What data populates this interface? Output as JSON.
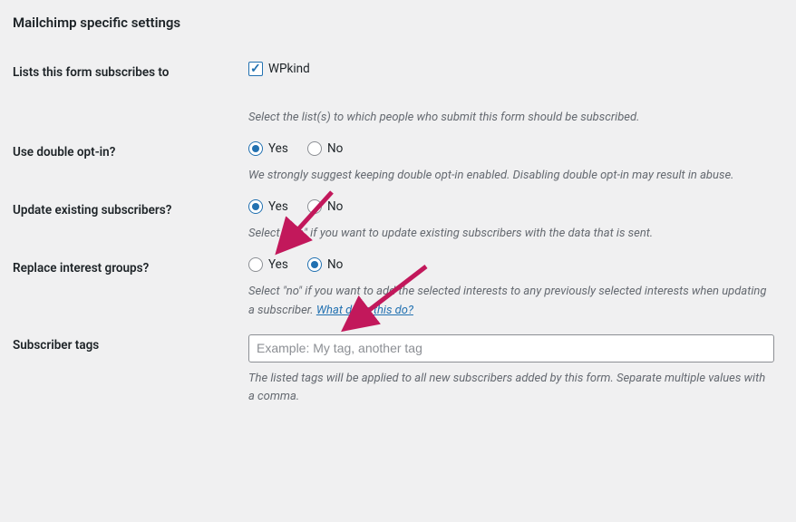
{
  "section": {
    "title": "Mailchimp specific settings"
  },
  "lists": {
    "label": "Lists this form subscribes to",
    "checkbox_label": "WPkind",
    "description": "Select the list(s) to which people who submit this form should be subscribed."
  },
  "double_opt_in": {
    "label": "Use double opt-in?",
    "yes": "Yes",
    "no": "No",
    "description": "We strongly suggest keeping double opt-in enabled. Disabling double opt-in may result in abuse."
  },
  "update_existing": {
    "label": "Update existing subscribers?",
    "yes": "Yes",
    "no": "No",
    "description": "Select \"yes\" if you want to update existing subscribers with the data that is sent."
  },
  "replace_interests": {
    "label": "Replace interest groups?",
    "yes": "Yes",
    "no": "No",
    "description_before": "Select \"no\" if you want to add the selected interests to any previously selected interests when updating a subscriber. ",
    "link_text": "What does this do?"
  },
  "subscriber_tags": {
    "label": "Subscriber tags",
    "placeholder": "Example: My tag, another tag",
    "description": "The listed tags will be applied to all new subscribers added by this form. Separate multiple values with a comma."
  }
}
